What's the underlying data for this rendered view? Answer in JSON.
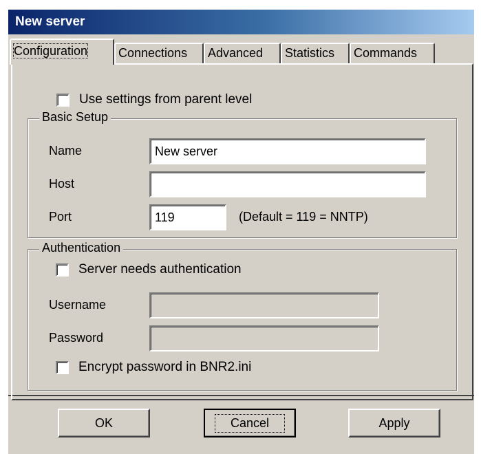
{
  "window": {
    "title": "New server"
  },
  "tabs": [
    {
      "label": "Configuration",
      "active": true
    },
    {
      "label": "Connections",
      "active": false
    },
    {
      "label": "Advanced",
      "active": false
    },
    {
      "label": "Statistics",
      "active": false
    },
    {
      "label": "Commands",
      "active": false
    }
  ],
  "config": {
    "use_parent_label": "Use settings from parent level",
    "use_parent_checked": false,
    "basic": {
      "title": "Basic Setup",
      "name_label": "Name",
      "name_value": "New server",
      "host_label": "Host",
      "host_value": "",
      "port_label": "Port",
      "port_value": "119",
      "port_hint": "(Default = 119 = NNTP)"
    },
    "auth": {
      "title": "Authentication",
      "needs_auth_label": "Server needs authentication",
      "needs_auth_checked": false,
      "username_label": "Username",
      "username_value": "",
      "password_label": "Password",
      "password_value": "",
      "encrypt_label": "Encrypt password in BNR2.ini",
      "encrypt_checked": false
    }
  },
  "buttons": {
    "ok": "OK",
    "cancel": "Cancel",
    "apply": "Apply"
  },
  "colors": {
    "face": "#d4d0c8",
    "title_start": "#0a246a",
    "title_end": "#a6caf0"
  }
}
